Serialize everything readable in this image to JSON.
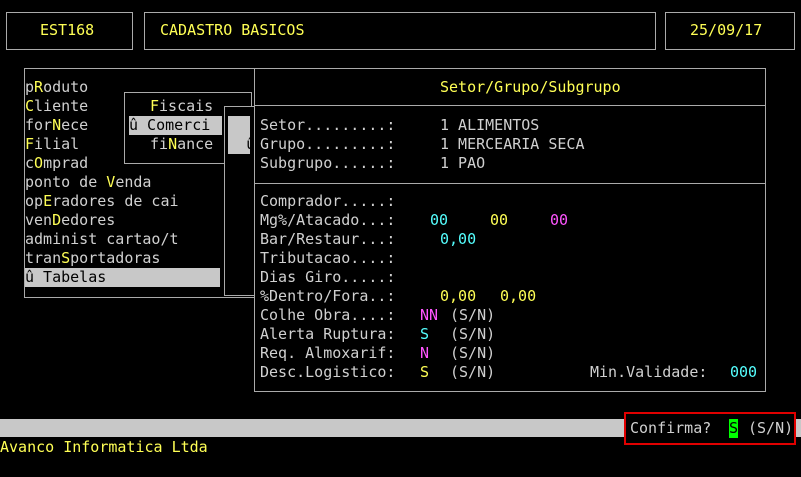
{
  "header": {
    "code": "EST168",
    "title": "CADASTRO BASICOS",
    "date": "25/09/17"
  },
  "main_menu": [
    {
      "pre": "p",
      "hot": "R",
      "post": "oduto"
    },
    {
      "pre": "",
      "hot": "C",
      "post": "liente"
    },
    {
      "pre": "for",
      "hot": "N",
      "post": "ece"
    },
    {
      "pre": "",
      "hot": "F",
      "post": "ilial"
    },
    {
      "pre": "c",
      "hot": "O",
      "post": "mprad"
    },
    {
      "pre": "ponto de ",
      "hot": "V",
      "post": "enda"
    },
    {
      "pre": "op",
      "hot": "E",
      "post": "radores de cai"
    },
    {
      "pre": "ven",
      "hot": "D",
      "post": "edores"
    },
    {
      "pre": "administ cartao/t",
      "hot": "",
      "post": ""
    },
    {
      "pre": "tran",
      "hot": "S",
      "post": "portadoras"
    },
    {
      "pre": "û Tabelas",
      "hot": "",
      "post": ""
    }
  ],
  "submenu": [
    {
      "pre": "",
      "hot": "F",
      "post": "iscais"
    },
    {
      "pre": "û Comerci",
      "hot": "",
      "post": ""
    },
    {
      "pre": "fi",
      "hot": "N",
      "post": "ance"
    }
  ],
  "submenu2_marker": "û",
  "panel": {
    "title": "Setor/Grupo/Subgrupo",
    "setor_label": "Setor.........:",
    "setor_value": "1 ALIMENTOS",
    "grupo_label": "Grupo.........:",
    "grupo_value": "1 MERCEARIA SECA",
    "subgrupo_label": "Subgrupo......:",
    "subgrupo_value": "1 PAO",
    "comprador_label": "Comprador.....:",
    "mg_label": "Mg%/Atacado...:",
    "mg_values": [
      "00",
      "00",
      "00"
    ],
    "bar_label": "Bar/Restaur...:",
    "bar_value": "0,00",
    "tributacao_label": "Tributacao....:",
    "dias_label": "Dias Giro.....:",
    "dentro_label": "%Dentro/Fora..:",
    "dentro_value1": "0,00",
    "dentro_value2": "0,00",
    "colhe_label": "Colhe Obra....:",
    "colhe_value": "NN",
    "alerta_label": "Alerta Ruptura:",
    "alerta_value": "S",
    "req_label": "Req. Almoxarif:",
    "req_value": "N",
    "desc_label": "Desc.Logistico:",
    "desc_value": "S",
    "sn": "(S/N)",
    "min_validade_label": "Min.Validade:",
    "min_validade_value": "000"
  },
  "status": {
    "confirm_label": "Confirma?",
    "confirm_value": "S",
    "confirm_options": "(S/N)"
  },
  "footer": {
    "company": "Avanco Informatica Ltda"
  },
  "colors": {
    "yellow": "#ffff55",
    "cyan": "#55ffff",
    "magenta": "#ff55ff",
    "highlight": "#c8c8c8",
    "confirm_border": "#e00000",
    "cursor": "#00ff00"
  }
}
